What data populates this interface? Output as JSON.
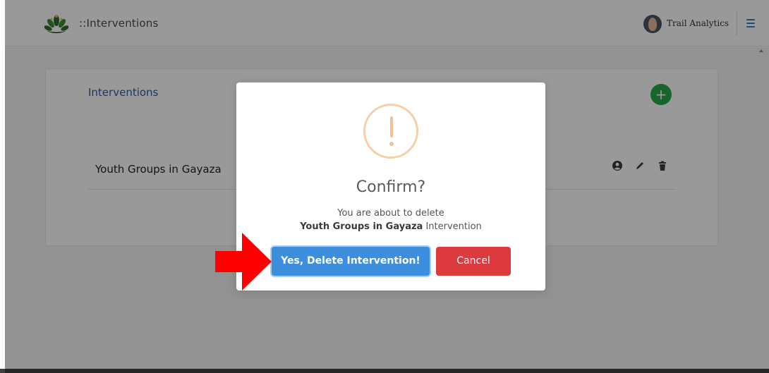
{
  "header": {
    "page_title": "::Interventions",
    "user_name": "Trail Analytics"
  },
  "card": {
    "title": "Interventions",
    "add_button": "+",
    "rows": [
      {
        "name": "Youth Groups in Gayaza"
      }
    ]
  },
  "modal": {
    "title": "Confirm?",
    "message_line1": "You are about to delete",
    "item_name": "Youth Groups in Gayaza",
    "item_suffix": " Intervention",
    "confirm_label": "Yes, Delete Intervention!",
    "cancel_label": "Cancel",
    "icon": "exclamation-icon"
  },
  "colors": {
    "accent_blue": "#3d8fde",
    "danger_red": "#dc3a3c",
    "add_green": "#29a84a",
    "warning_orange": "#f3c195",
    "annotation_arrow": "#ff0000"
  }
}
